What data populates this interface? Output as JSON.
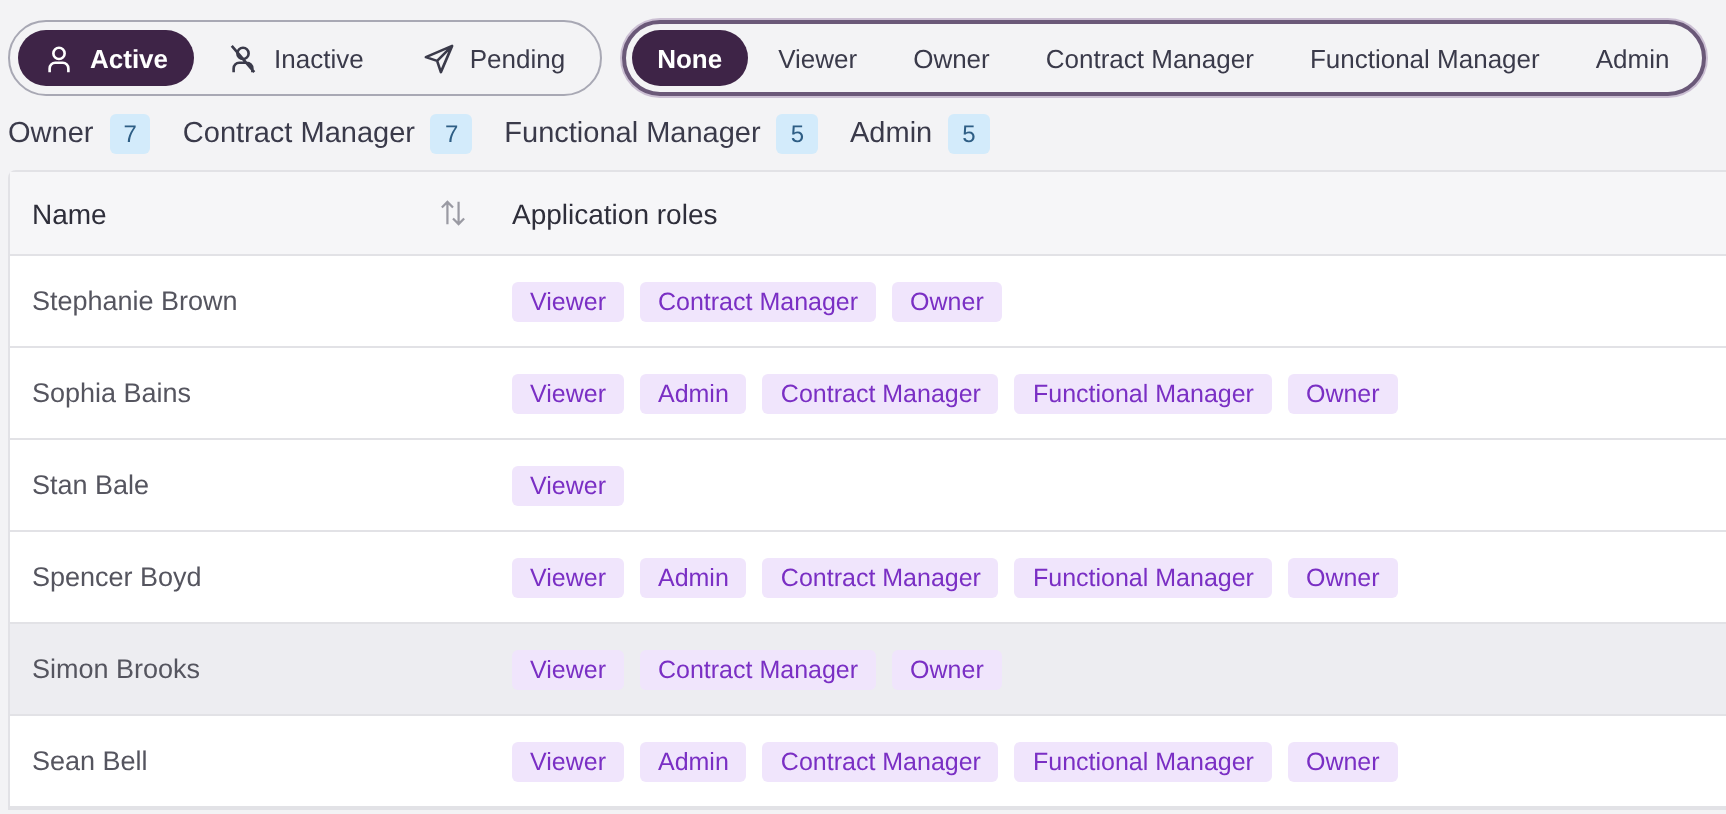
{
  "status_filter": [
    {
      "label": "Active",
      "kind": "person",
      "selected": true
    },
    {
      "label": "Inactive",
      "kind": "person-off",
      "selected": false
    },
    {
      "label": "Pending",
      "kind": "send",
      "selected": false
    }
  ],
  "role_filter": [
    {
      "label": "None",
      "selected": true
    },
    {
      "label": "Viewer",
      "selected": false
    },
    {
      "label": "Owner",
      "selected": false
    },
    {
      "label": "Contract Manager",
      "selected": false
    },
    {
      "label": "Functional Manager",
      "selected": false
    },
    {
      "label": "Admin",
      "selected": false
    }
  ],
  "role_counts": [
    {
      "label": "Owner",
      "count": "7"
    },
    {
      "label": "Contract Manager",
      "count": "7"
    },
    {
      "label": "Functional Manager",
      "count": "5"
    },
    {
      "label": "Admin",
      "count": "5"
    }
  ],
  "table": {
    "columns": [
      "Name",
      "Application roles"
    ],
    "rows": [
      {
        "name": "Stephanie Brown",
        "roles": [
          "Viewer",
          "Contract Manager",
          "Owner"
        ],
        "highlighted": false
      },
      {
        "name": "Sophia Bains",
        "roles": [
          "Viewer",
          "Admin",
          "Contract Manager",
          "Functional Manager",
          "Owner"
        ],
        "highlighted": false
      },
      {
        "name": "Stan Bale",
        "roles": [
          "Viewer"
        ],
        "highlighted": false
      },
      {
        "name": "Spencer Boyd",
        "roles": [
          "Viewer",
          "Admin",
          "Contract Manager",
          "Functional Manager",
          "Owner"
        ],
        "highlighted": false
      },
      {
        "name": "Simon Brooks",
        "roles": [
          "Viewer",
          "Contract Manager",
          "Owner"
        ],
        "highlighted": true
      },
      {
        "name": "Sean Bell",
        "roles": [
          "Viewer",
          "Admin",
          "Contract Manager",
          "Functional Manager",
          "Owner"
        ],
        "highlighted": false
      }
    ]
  }
}
